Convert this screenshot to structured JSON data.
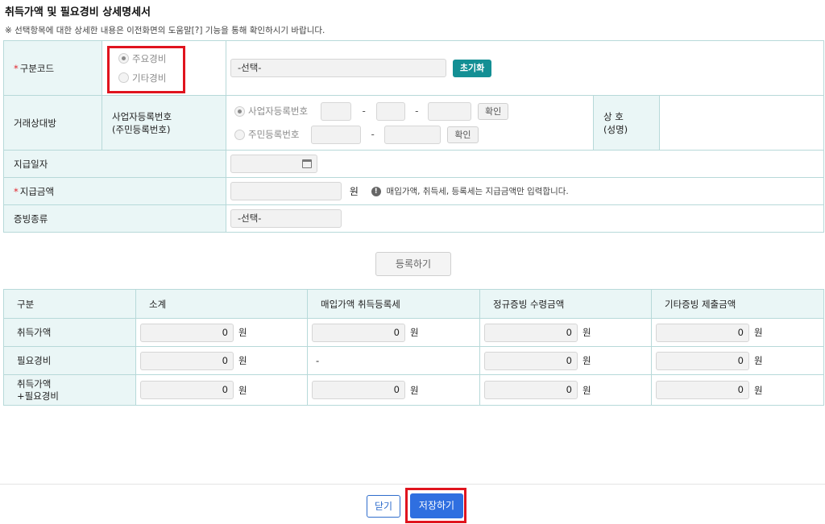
{
  "page": {
    "title": "취득가액 및 필요경비 상세명세서",
    "notice": "※ 선택항목에 대한 상세한 내용은 이전화면의 도움말[?] 기능을 통해 확인하시기 바랍니다."
  },
  "form": {
    "division_code": {
      "label": "구분코드",
      "required_mark": "*",
      "options": [
        "주요경비",
        "기타경비"
      ],
      "selected": "주요경비",
      "select_value": "-선택-",
      "reset_label": "초기화"
    },
    "counterparty": {
      "label": "거래상대방",
      "sublabel_line1": "사업자등록번호",
      "sublabel_line2": "(주민등록번호)",
      "options": [
        "사업자등록번호",
        "주민등록번호"
      ],
      "selected": "사업자등록번호",
      "dash": "-",
      "confirm_label": "확인",
      "company_label_line1": "상 호",
      "company_label_line2": "(성명)"
    },
    "pay_date": {
      "label": "지급일자",
      "calendar_icon": "calendar-icon"
    },
    "pay_amount": {
      "label": "지급금액",
      "required_mark": "*",
      "unit": "원",
      "hint": "매입가액, 취득세, 등록세는 지급금액만 입력합니다.",
      "hint_icon": "!"
    },
    "evidence_type": {
      "label": "증빙종류",
      "select_value": "-선택-"
    },
    "register_label": "등록하기"
  },
  "summary": {
    "headers": [
      "구분",
      "소계",
      "매입가액 취득등록세",
      "정규증빙 수령금액",
      "기타증빙 제출금액"
    ],
    "rows": [
      {
        "label": "취득가액",
        "cells": [
          "0",
          "0",
          "0",
          "0"
        ]
      },
      {
        "label": "필요경비",
        "cells": [
          "0",
          "-",
          "0",
          "0"
        ]
      },
      {
        "label_line1": "취득가액",
        "label_line2": "+필요경비",
        "cells": [
          "0",
          "0",
          "0",
          "0"
        ]
      }
    ],
    "unit": "원"
  },
  "footer": {
    "close_label": "닫기",
    "save_label": "저장하기"
  },
  "colors": {
    "header_bg": "#eaf6f6",
    "border": "#b7d9d9",
    "accent_teal": "#138f94",
    "save_blue": "#2f6fe0",
    "highlight_red": "#e0141e"
  }
}
